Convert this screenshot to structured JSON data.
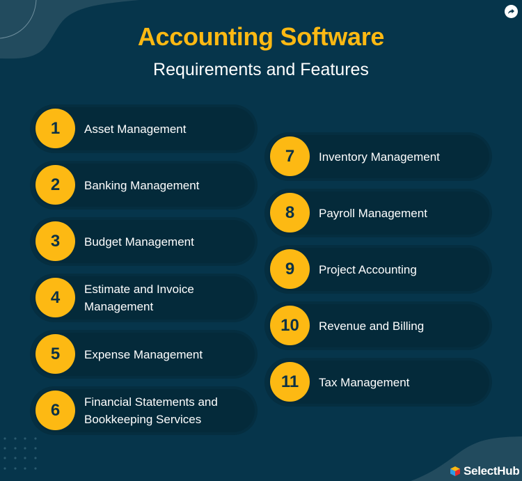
{
  "header": {
    "title": "Accounting Software",
    "subtitle": "Requirements and Features"
  },
  "share_icon": "share-arrow-icon",
  "items": [
    {
      "number": "1",
      "label": "Asset Management"
    },
    {
      "number": "2",
      "label": "Banking Management"
    },
    {
      "number": "3",
      "label": "Budget Management"
    },
    {
      "number": "4",
      "label": "Estimate and Invoice Management"
    },
    {
      "number": "5",
      "label": "Expense Management"
    },
    {
      "number": "6",
      "label": "Financial Statements and Bookkeeping Services"
    },
    {
      "number": "7",
      "label": "Inventory Management"
    },
    {
      "number": "8",
      "label": "Payroll Management"
    },
    {
      "number": "9",
      "label": "Project Accounting"
    },
    {
      "number": "10",
      "label": "Revenue and Billing"
    },
    {
      "number": "11",
      "label": "Tax Management"
    }
  ],
  "brand": {
    "name": "SelectHub"
  },
  "colors": {
    "background": "#06354b",
    "accent": "#fdb913",
    "pill": "#042a3a",
    "text": "#ffffff",
    "number_text": "#0c3145"
  }
}
